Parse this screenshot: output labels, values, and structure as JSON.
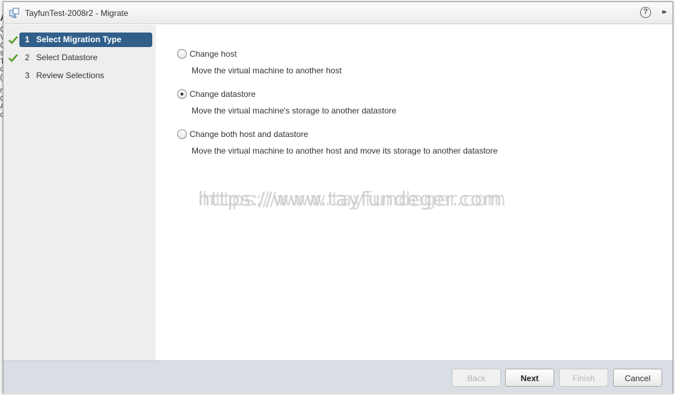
{
  "window": {
    "title": "TayfunTest-2008r2 - Migrate",
    "title_icon": "vm-migrate-icon",
    "help_glyph": "?",
    "collapse_glyph": "▸▸"
  },
  "background": {
    "letters": [
      "A",
      "",
      "",
      "C",
      "V",
      "C",
      "s",
      "T",
      "c",
      "(",
      "",
      "n",
      "",
      "C",
      "A",
      "c"
    ]
  },
  "steps": [
    {
      "num": "1",
      "label": "Select Migration Type",
      "status": "complete",
      "active": true
    },
    {
      "num": "2",
      "label": "Select Datastore",
      "status": "complete",
      "active": false
    },
    {
      "num": "3",
      "label": "Review Selections",
      "status": "pending",
      "active": false
    }
  ],
  "options": [
    {
      "label": "Change host",
      "description": "Move the virtual machine to another host",
      "checked": false
    },
    {
      "label": "Change datastore",
      "description": "Move the virtual machine's storage to another datastore",
      "checked": true
    },
    {
      "label": "Change both host and datastore",
      "description": "Move the virtual machine to another host and move its storage to another datastore",
      "checked": false
    }
  ],
  "watermark": "https://www.tayfundeger.com",
  "buttons": {
    "back": {
      "label": "Back",
      "enabled": false
    },
    "next": {
      "label": "Next",
      "enabled": true
    },
    "finish": {
      "label": "Finish",
      "enabled": false
    },
    "cancel": {
      "label": "Cancel",
      "enabled": true
    }
  },
  "colors": {
    "active_step_bg": "#315f8a",
    "check": "#5aa02c",
    "footer_bg": "#d9dde4",
    "sidebar_bg": "#eeeeee"
  }
}
